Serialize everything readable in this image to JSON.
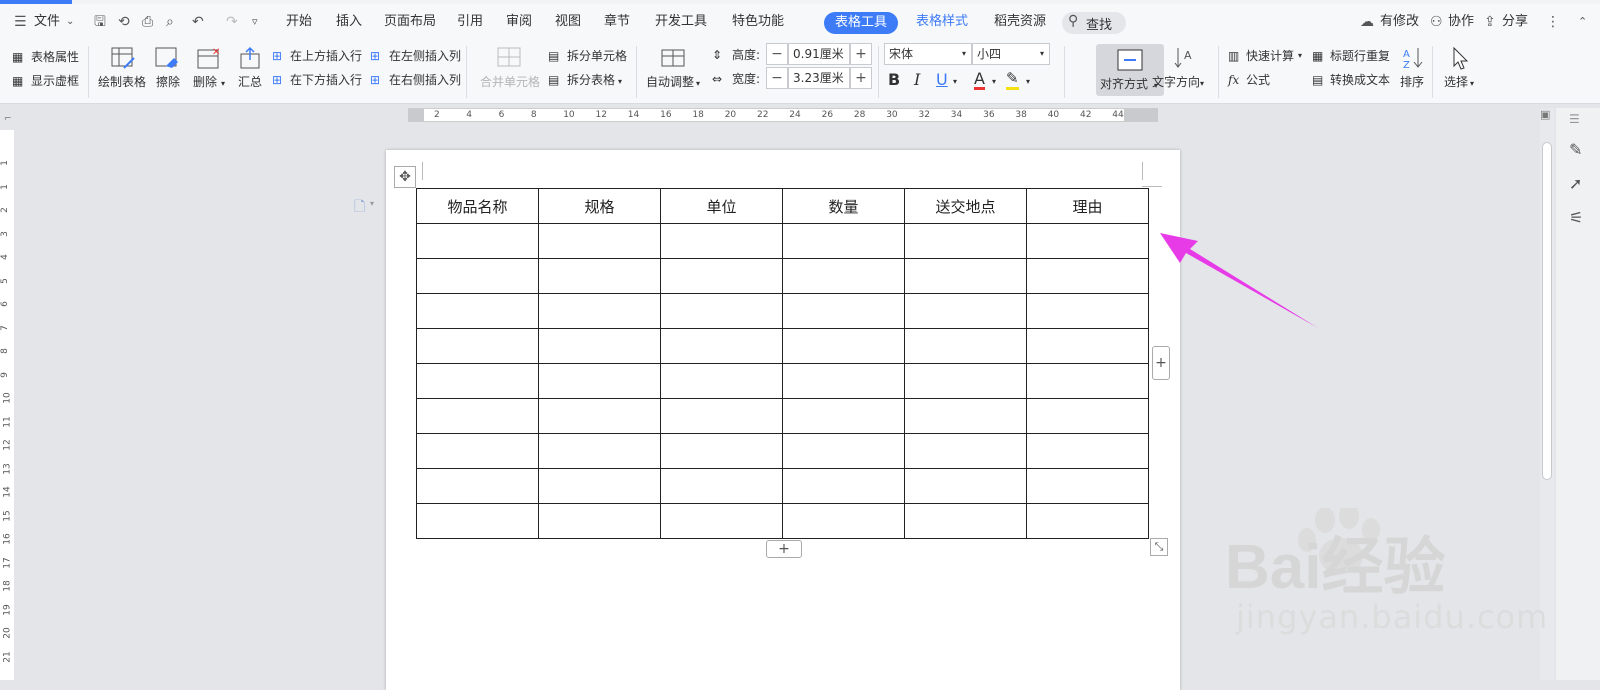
{
  "menu": {
    "file": "文件",
    "tabs": [
      "开始",
      "插入",
      "页面布局",
      "引用",
      "审阅",
      "视图",
      "章节",
      "开发工具",
      "特色功能"
    ],
    "active_tab": "表格工具",
    "style_tab": "表格样式",
    "resource_tab": "稻壳资源",
    "search": "查找",
    "modified": "有修改",
    "collab": "协作",
    "share": "分享"
  },
  "ribbon": {
    "table_props": "表格属性",
    "show_grid": "显示虚框",
    "draw_table": "绘制表格",
    "erase": "擦除",
    "delete": "删除",
    "summary": "汇总",
    "insert_above": "在上方插入行",
    "insert_below": "在下方插入行",
    "insert_left": "在左侧插入列",
    "insert_right": "在右侧插入列",
    "merge_cells": "合并单元格",
    "split_cells": "拆分单元格",
    "split_table": "拆分表格",
    "auto_adjust": "自动调整",
    "height_label": "高度:",
    "height_value": "0.91厘米",
    "width_label": "宽度:",
    "width_value": "3.23厘米",
    "font_name": "宋体",
    "font_size": "小四",
    "bold": "B",
    "italic": "I",
    "underline": "U",
    "font_color": "A",
    "align": "对齐方式",
    "text_dir": "文字方向",
    "quick_calc": "快速计算",
    "repeat_header": "标题行重复",
    "formula": "公式",
    "to_text": "转换成文本",
    "sort": "排序",
    "select": "选择"
  },
  "ruler": {
    "h_ticks": [
      "2",
      "4",
      "6",
      "8",
      "10",
      "12",
      "14",
      "16",
      "18",
      "20",
      "22",
      "24",
      "26",
      "28",
      "30",
      "32",
      "34",
      "36",
      "38",
      "40",
      "42",
      "44"
    ],
    "v_ticks": [
      "1",
      "1",
      "2",
      "3",
      "4",
      "5",
      "6",
      "7",
      "8",
      "9",
      "10",
      "11",
      "12",
      "13",
      "14",
      "15",
      "16",
      "17",
      "18",
      "19",
      "20",
      "21"
    ]
  },
  "table": {
    "headers": [
      "物品名称",
      "规格",
      "单位",
      "数量",
      "送交地点",
      "理由"
    ],
    "empty_rows": 9
  },
  "watermark": {
    "brand": "Bai经验",
    "url": "jingyan.baidu.com"
  },
  "colors": {
    "accent": "#3d7bf7",
    "arrow": "#e83be8"
  }
}
